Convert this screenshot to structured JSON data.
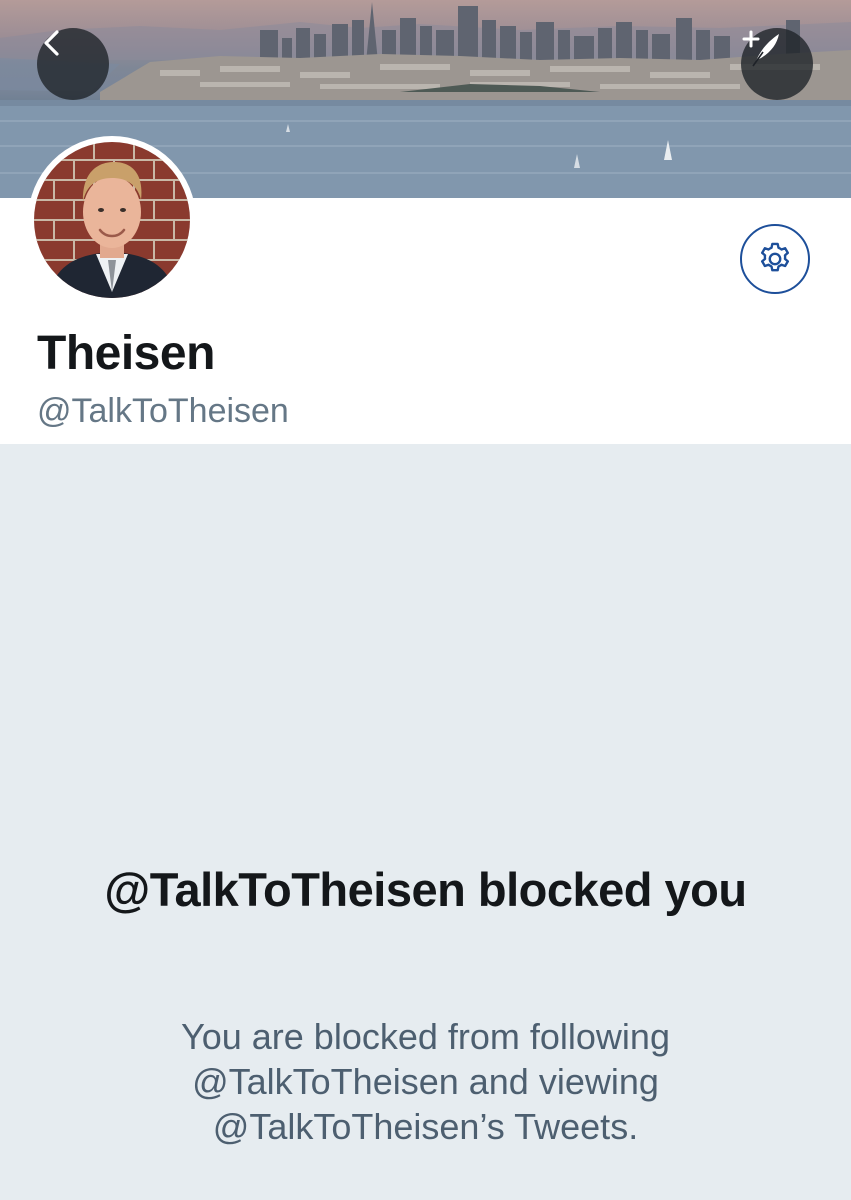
{
  "header": {
    "back_icon": "chevron-left-icon",
    "compose_icon": "compose-tweet-icon"
  },
  "profile": {
    "display_name": "Theisen",
    "handle": "@TalkToTheisen",
    "settings_icon": "gear-icon"
  },
  "blocked": {
    "title": "@TalkToTheisen blocked you",
    "description": "You are blocked from following @TalkToTheisen and viewing @TalkToTheisen’s Tweets."
  },
  "colors": {
    "accent": "#1d4f9a",
    "background": "#e6ecf0",
    "text_primary": "#14171a",
    "text_secondary": "#657786"
  }
}
